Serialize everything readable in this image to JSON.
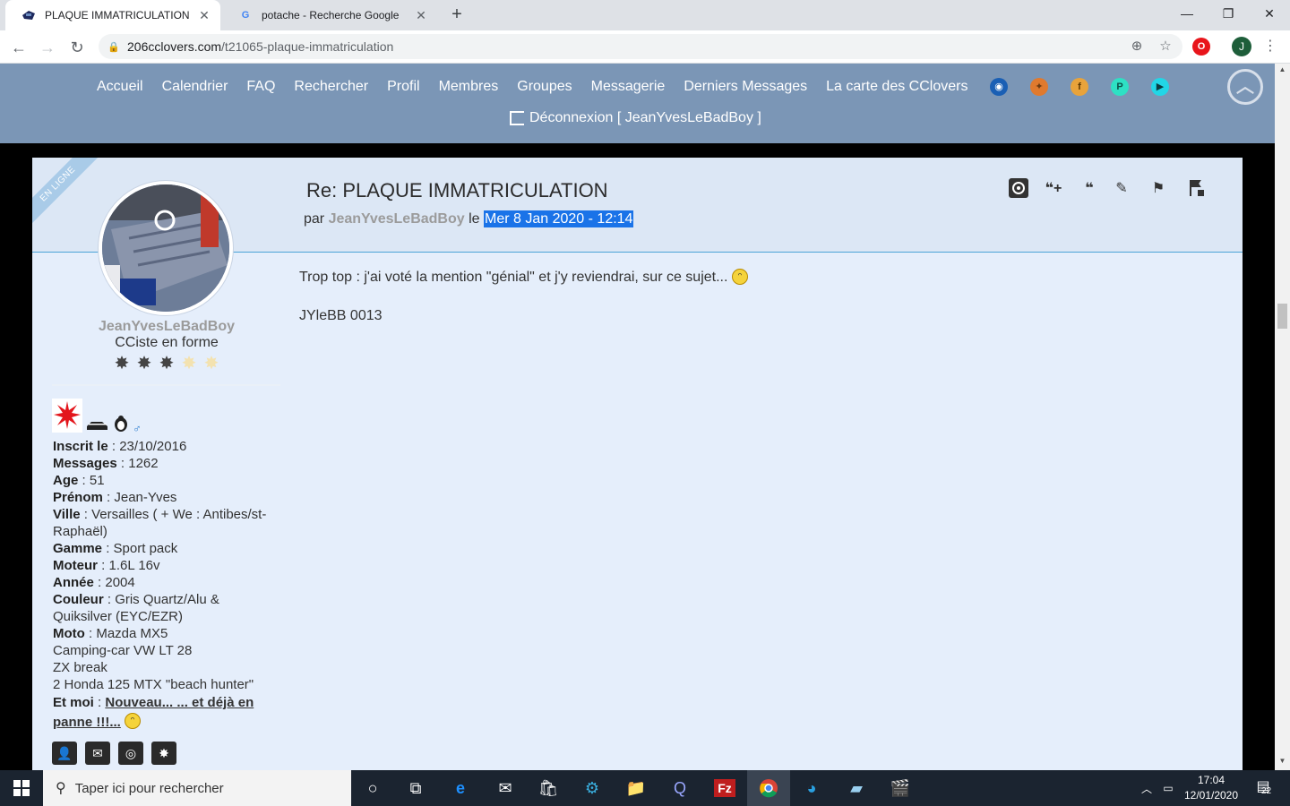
{
  "browser": {
    "tabs": [
      {
        "title": "PLAQUE IMMATRICULATION",
        "active": true
      },
      {
        "title": "potache - Recherche Google",
        "active": false
      }
    ],
    "url_host": "206cclovers.com",
    "url_path": "/t21065-plaque-immatriculation",
    "profile_initial": "J"
  },
  "site_nav": {
    "links": [
      "Accueil",
      "Calendrier",
      "FAQ",
      "Rechercher",
      "Profil",
      "Membres",
      "Groupes",
      "Messagerie",
      "Derniers Messages",
      "La carte des CClovers"
    ],
    "logout": "Déconnexion [ JeanYvesLeBadBoy ]",
    "social_icons": [
      "wifi-icon",
      "twitter-icon",
      "facebook-icon",
      "pinterest-icon",
      "youtube-icon"
    ]
  },
  "post": {
    "online_ribbon": "EN LIGNE",
    "title": "Re: PLAQUE IMMATRICULATION",
    "meta_prefix": "par",
    "author": "JeanYvesLeBadBoy",
    "meta_mid": "le",
    "date": "Mer 8 Jan 2020 - 12:14",
    "body": "Trop top : j'ai voté la mention \"génial\" et j'y reviendrai, sur ce sujet...",
    "signature": "JYleBB 0013",
    "action_icons": [
      "mention-icon",
      "multiquote-icon",
      "quote-icon",
      "edit-icon",
      "report-icon",
      "split-icon"
    ]
  },
  "user": {
    "username": "JeanYvesLeBadBoy",
    "rank": "CCiste en forme",
    "rank_stars_filled": 3,
    "rank_stars_total": 5,
    "fields": [
      {
        "label": "Inscrit le",
        "value": "23/10/2016"
      },
      {
        "label": "Messages",
        "value": "1262"
      },
      {
        "label": "Age",
        "value": "51"
      },
      {
        "label": "Prénom",
        "value": "Jean-Yves"
      },
      {
        "label": "Ville",
        "value": "Versailles ( + We : Antibes/st-Raphaël)"
      },
      {
        "label": "Gamme",
        "value": "Sport pack"
      },
      {
        "label": "Moteur",
        "value": "1.6L 16v"
      },
      {
        "label": "Année",
        "value": "2004"
      },
      {
        "label": "Couleur",
        "value": "Gris Quartz/Alu & Quiksilver (EYC/EZR)"
      },
      {
        "label": "Moto",
        "value": "Mazda MX5"
      }
    ],
    "extra_lines": [
      "Camping-car VW LT 28",
      "ZX break",
      "2 Honda 125 MTX \"beach hunter\""
    ],
    "et_moi_label": "Et moi",
    "et_moi_link": "Nouveau... ... et déjà en panne !!!..."
  },
  "taskbar": {
    "search_placeholder": "Taper ici pour rechercher",
    "time": "17:04",
    "date": "12/01/2020",
    "notifications": "22"
  },
  "colors": {
    "nav_bg": "#7b96b6",
    "post_bg": "#e5eefb",
    "accent_line": "#4ba3d6",
    "date_highlight": "#1a73e8"
  }
}
